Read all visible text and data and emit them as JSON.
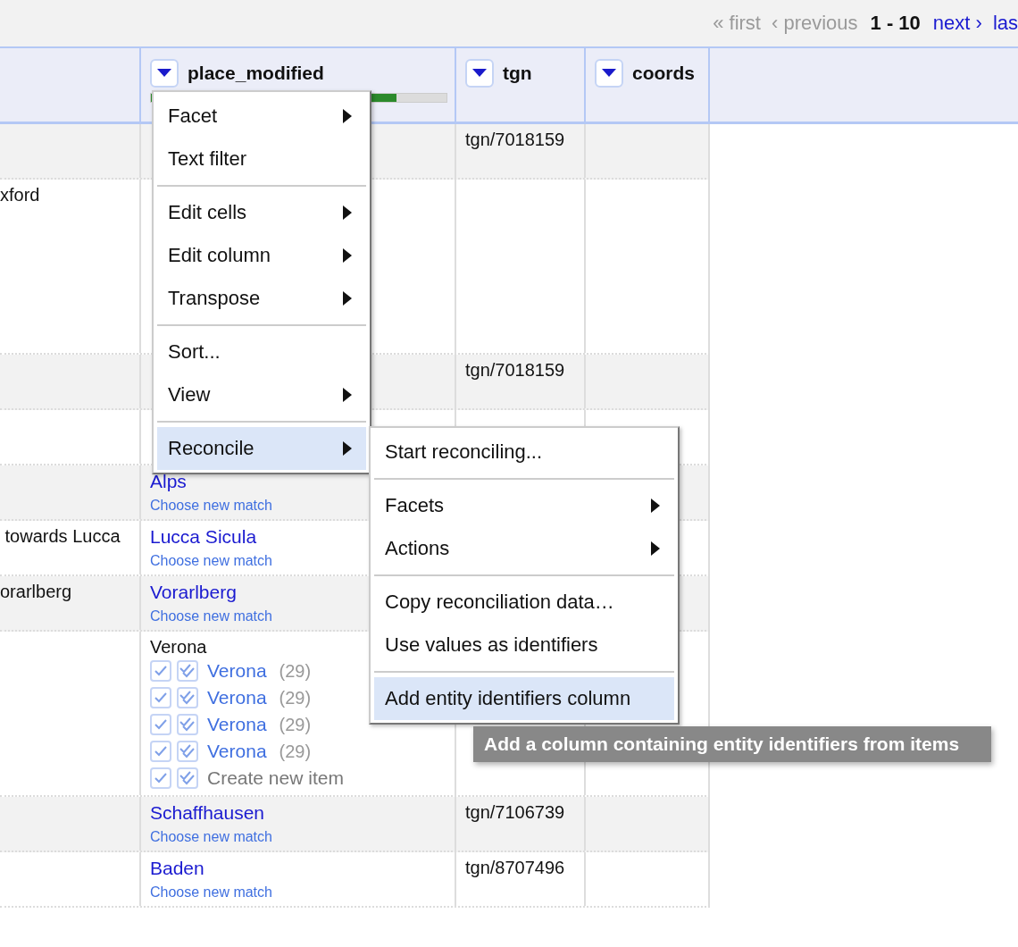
{
  "pager": [
    {
      "label": "« first",
      "kind": "nav",
      "disabled": true
    },
    {
      "label": "‹ previous",
      "kind": "nav",
      "disabled": true
    },
    {
      "label": "1 - 10",
      "kind": "range"
    },
    {
      "label": "next ›",
      "kind": "nav",
      "disabled": false
    },
    {
      "label": "las",
      "kind": "nav",
      "disabled": false
    }
  ],
  "table": {
    "columns": [
      {
        "label": "place_modified",
        "level": 0.83
      },
      {
        "label": "tgn"
      },
      {
        "label": "coords"
      }
    ],
    "rows": [
      {
        "column_1": "",
        "place": {
          "kind": "empty"
        },
        "tgn": "tgn/7018159",
        "tall": false
      },
      {
        "column_1": "xford",
        "place": {
          "kind": "empty"
        },
        "tgn": "",
        "tall": true
      },
      {
        "column_1": "",
        "place": {
          "kind": "empty"
        },
        "tgn": "tgn/7018159",
        "tall": false
      },
      {
        "column_1": "",
        "place": {
          "kind": "empty"
        },
        "tgn": "",
        "tall": false
      },
      {
        "column_1": "",
        "place": {
          "kind": "match",
          "name": "Alps",
          "action": "Choose new match"
        },
        "tgn": "",
        "tall": false
      },
      {
        "column_1": " towards Lucca",
        "place": {
          "kind": "match",
          "name": "Lucca Sicula",
          "action": "Choose new match"
        },
        "tgn": "",
        "tall": false
      },
      {
        "column_1": "orarlberg",
        "place": {
          "kind": "match",
          "name": "Vorarlberg",
          "action": "Choose new match"
        },
        "tgn": "",
        "tall": false
      },
      {
        "column_1": "",
        "place": {
          "kind": "candidates",
          "value": "Verona",
          "candidates": [
            {
              "kind": "candidate",
              "name": "Verona",
              "count": "(29)"
            },
            {
              "kind": "candidate",
              "name": "Verona",
              "count": "(29)"
            },
            {
              "kind": "candidate",
              "name": "Verona",
              "count": "(29)"
            },
            {
              "kind": "candidate",
              "name": "Verona",
              "count": "(29)"
            },
            {
              "kind": "new",
              "name": "Create new item"
            }
          ]
        },
        "tgn": "",
        "tall": false
      },
      {
        "column_1": "",
        "place": {
          "kind": "match",
          "name": "Schaffhausen",
          "action": "Choose new match"
        },
        "tgn": "tgn/7106739",
        "tall": false
      },
      {
        "column_1": "",
        "place": {
          "kind": "match",
          "name": "Baden",
          "action": "Choose new match"
        },
        "tgn": "tgn/8707496",
        "tall": false
      }
    ]
  },
  "column_menu": {
    "items": [
      {
        "kind": "item",
        "label": "Facet",
        "submenu": true,
        "selected": false
      },
      {
        "kind": "item",
        "label": "Text filter",
        "submenu": false,
        "selected": false
      },
      {
        "kind": "separator"
      },
      {
        "kind": "item",
        "label": "Edit cells",
        "submenu": true,
        "selected": false
      },
      {
        "kind": "item",
        "label": "Edit column",
        "submenu": true,
        "selected": false
      },
      {
        "kind": "item",
        "label": "Transpose",
        "submenu": true,
        "selected": false
      },
      {
        "kind": "separator"
      },
      {
        "kind": "item",
        "label": "Sort...",
        "submenu": false,
        "selected": false
      },
      {
        "kind": "item",
        "label": "View",
        "submenu": true,
        "selected": false
      },
      {
        "kind": "separator"
      },
      {
        "kind": "item",
        "label": "Reconcile",
        "submenu": true,
        "selected": true
      }
    ]
  },
  "reconcile_menu": {
    "items": [
      {
        "kind": "item",
        "label": "Start reconciling...",
        "submenu": false,
        "selected": false
      },
      {
        "kind": "separator"
      },
      {
        "kind": "item",
        "label": "Facets",
        "submenu": true,
        "selected": false
      },
      {
        "kind": "item",
        "label": "Actions",
        "submenu": true,
        "selected": false
      },
      {
        "kind": "separator"
      },
      {
        "kind": "item",
        "label": "Copy reconciliation data…",
        "submenu": false,
        "selected": false
      },
      {
        "kind": "item",
        "label": "Use values as identifiers",
        "submenu": false,
        "selected": false
      },
      {
        "kind": "separator"
      },
      {
        "kind": "item",
        "label": "Add entity identifiers column",
        "submenu": false,
        "selected": true
      }
    ]
  },
  "tooltip": "Add a column containing entity identifiers from items"
}
